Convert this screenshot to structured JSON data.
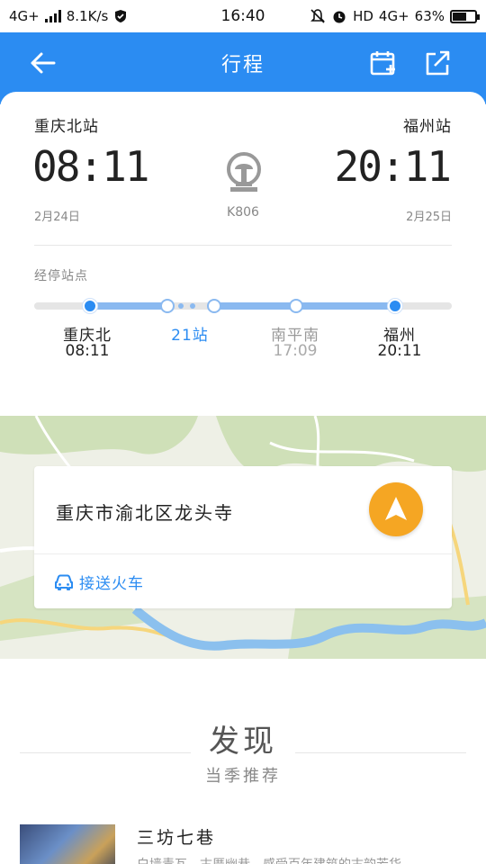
{
  "status_bar": {
    "network_left": "4G+",
    "speed": "8.1K/s",
    "time": "16:40",
    "hd": "HD",
    "network_right": "4G+",
    "battery": "63%",
    "battery_level": 0.63
  },
  "appbar": {
    "title": "行程",
    "color": "#2b8cf2"
  },
  "trip": {
    "from_station": "重庆北站",
    "to_station": "福州站",
    "depart_time": "08:11",
    "arrive_time": "20:11",
    "depart_date": "2月24日",
    "arrive_date": "2月25日",
    "train_no": "K806"
  },
  "stops": {
    "label": "经停站点",
    "items": [
      {
        "name": "重庆北",
        "time": "08:11"
      },
      {
        "name": "21站",
        "time": ""
      },
      {
        "name": "南平南",
        "time": "17:09"
      },
      {
        "name": "福州",
        "time": "20:11"
      }
    ]
  },
  "location": {
    "name": "重庆市渝北区龙头寺",
    "pickup_label": "接送火车"
  },
  "discover": {
    "title": "发现",
    "subtitle": "当季推荐",
    "items": [
      {
        "title": "三坊七巷",
        "desc": "白墙青瓦，古厝幽巷，感受百年建筑的古韵芳华"
      }
    ]
  },
  "icons": {
    "back": "arrow-left-icon",
    "calendar": "calendar-add-icon",
    "share": "share-icon",
    "train": "railway-logo-icon",
    "navigate": "navigation-arrow-icon",
    "car": "car-icon"
  }
}
